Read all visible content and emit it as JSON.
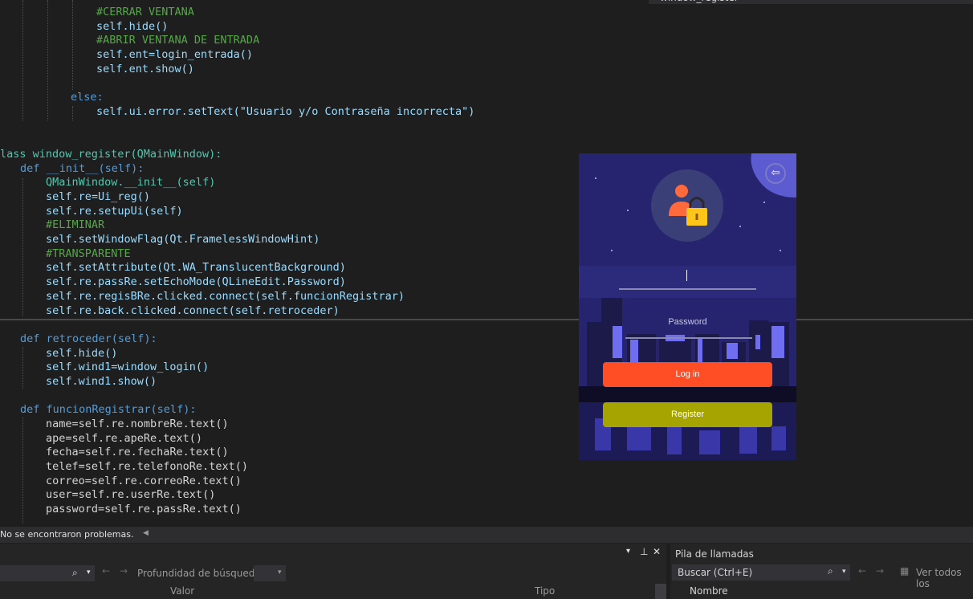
{
  "top_tab": {
    "label": "window_register"
  },
  "code": {
    "lines": [
      "#CERRAR VENTANA",
      "self.hide()",
      "#ABRIR VENTANA DE ENTRADA",
      "self.ent=login_entrada()",
      "self.ent.show()",
      "else:",
      "self.ui.error.setText(\"Usuario y/o Contraseña incorrecta\")",
      "lass window_register(QMainWindow):",
      "def __init__(self):",
      "QMainWindow.__init__(self)",
      "self.re=Ui_reg()",
      "self.re.setupUi(self)",
      "#ELIMINAR",
      "self.setWindowFlag(Qt.FramelessWindowHint)",
      "#TRANSPARENTE",
      "self.setAttribute(Qt.WA_TranslucentBackground)",
      "self.re.passRe.setEchoMode(QLineEdit.Password)",
      "self.re.regisBRe.clicked.connect(self.funcionRegistrar)",
      "self.re.back.clicked.connect(self.retroceder)",
      "def retroceder(self):",
      "self.hide()",
      "self.wind1=window_login()",
      "self.wind1.show()",
      "def funcionRegistrar(self):",
      "name=self.re.nombreRe.text()",
      "ape=self.re.apeRe.text()",
      "fecha=self.re.fechaRe.text()",
      "telef=self.re.telefonoRe.text()",
      "correo=self.re.correoRe.text()",
      "user=self.re.userRe.text()",
      "password=self.re.passRe.text()"
    ]
  },
  "login_window": {
    "password_label": "Password",
    "login_button": "Log in",
    "register_button": "Register",
    "colors": {
      "login": "#ff4e26",
      "register": "#a6a400",
      "sky": "#26246e"
    }
  },
  "error_list": {
    "status": "No se encontraron problemas."
  },
  "bottom_left": {
    "search_icon": "search-icon",
    "depth_label": "Profundidad de búsqueda:",
    "col_valor": "Valor",
    "col_tipo": "Tipo"
  },
  "bottom_right": {
    "title": "Pila de llamadas",
    "search_placeholder": "Buscar (Ctrl+E)",
    "view_all": "Ver todos los",
    "col_nombre": "Nombre"
  }
}
